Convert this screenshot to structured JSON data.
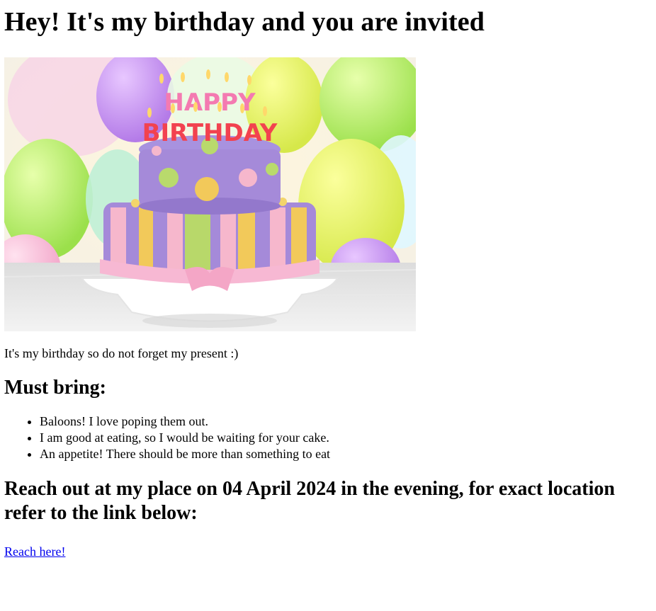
{
  "heading": "Hey! It's my birthday and you are invited",
  "image": {
    "icon": "birthday-cake-photo",
    "cake_text_line1": "HAPPY",
    "cake_text_line2": "BIRTHDAY"
  },
  "note": "It's my birthday so do not forget my present :)",
  "must_bring": {
    "title": "Must bring:",
    "items": [
      "Baloons! I love poping them out.",
      "I am good at eating, so I would be waiting for your cake.",
      "An appetite! There should be more than something to eat"
    ]
  },
  "reach": {
    "title": "Reach out at my place on 04 April 2024 in the evening, for exact location refer to the link below:",
    "link_label": "Reach here!"
  },
  "colors": {
    "link": "#0000ee"
  }
}
